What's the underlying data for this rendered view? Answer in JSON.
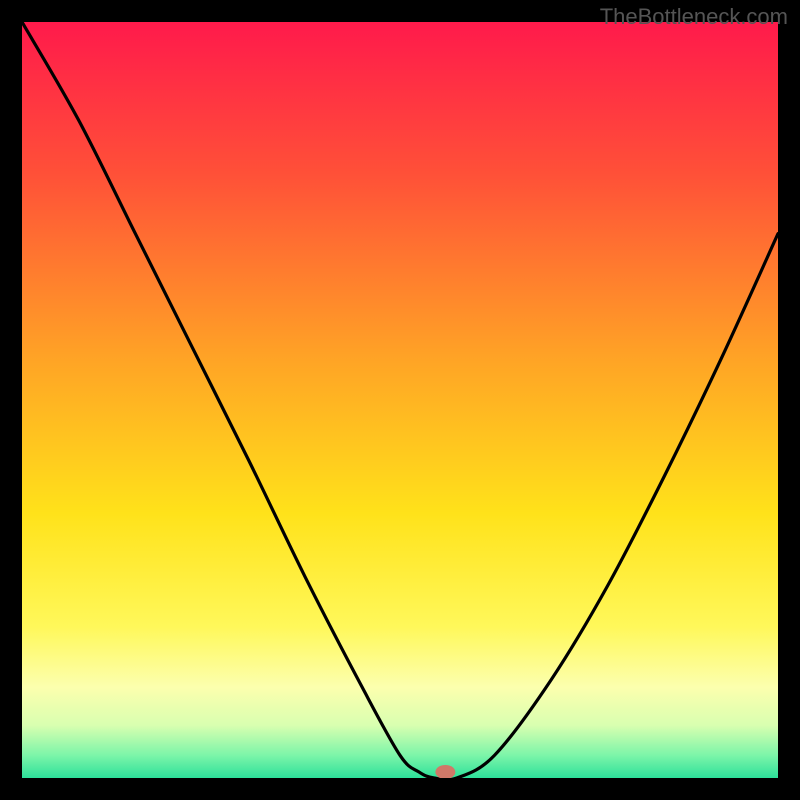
{
  "watermark": "TheBottleneck.com",
  "chart_data": {
    "type": "line",
    "title": "",
    "xlabel": "",
    "ylabel": "",
    "xlim": [
      0,
      1
    ],
    "ylim": [
      0,
      1
    ],
    "series": [
      {
        "name": "curve",
        "x": [
          0.0,
          0.075,
          0.15,
          0.225,
          0.3,
          0.375,
          0.45,
          0.5,
          0.525,
          0.545,
          0.575,
          0.625,
          0.7,
          0.775,
          0.85,
          0.925,
          1.0
        ],
        "y": [
          1.0,
          0.87,
          0.72,
          0.57,
          0.42,
          0.265,
          0.12,
          0.03,
          0.008,
          0.0,
          0.0,
          0.03,
          0.13,
          0.255,
          0.4,
          0.555,
          0.72
        ]
      }
    ],
    "marker": {
      "x": 0.56,
      "y": 0.0
    },
    "background_gradient": {
      "stops": [
        {
          "offset": 0.0,
          "color": "#ff1a4b"
        },
        {
          "offset": 0.2,
          "color": "#ff5038"
        },
        {
          "offset": 0.45,
          "color": "#ffa525"
        },
        {
          "offset": 0.65,
          "color": "#ffe21a"
        },
        {
          "offset": 0.8,
          "color": "#fff85a"
        },
        {
          "offset": 0.88,
          "color": "#fcffae"
        },
        {
          "offset": 0.93,
          "color": "#d9ffb0"
        },
        {
          "offset": 0.97,
          "color": "#7cf5a9"
        },
        {
          "offset": 1.0,
          "color": "#2de09a"
        }
      ]
    }
  }
}
